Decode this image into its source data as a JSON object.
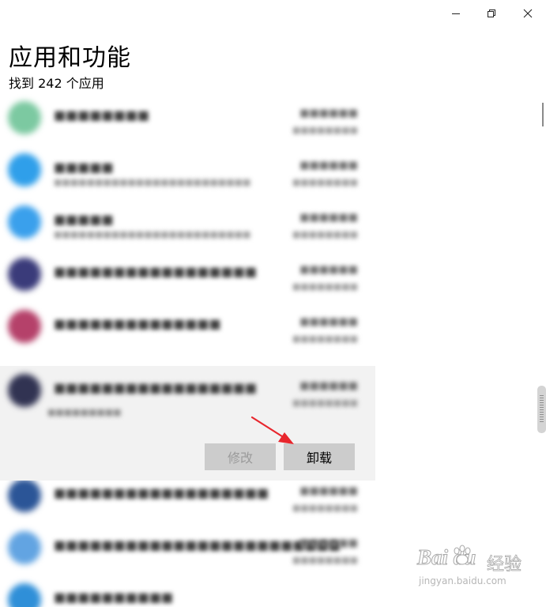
{
  "window": {
    "controls": {
      "minimize": "minimize-icon",
      "restore": "restore-icon",
      "close": "close-icon"
    }
  },
  "header": {
    "title": "应用和功能",
    "count_text": "找到 242 个应用"
  },
  "app_list": {
    "rows": [
      {
        "icon_color": "#7cc9a1"
      },
      {
        "icon_color": "#2f9fea"
      },
      {
        "icon_color": "#3aa0ec"
      },
      {
        "icon_color": "#3a3b7a"
      },
      {
        "icon_color": "#b5416a"
      },
      {
        "icon_color": "#313352"
      },
      {
        "icon_color": "#2b5597"
      },
      {
        "icon_color": "#62a4e2"
      },
      {
        "icon_color": "#2f8fd8"
      }
    ]
  },
  "selected_app": {
    "modify_label": "修改",
    "uninstall_label": "卸载"
  },
  "annotation": {
    "arrow_color": "#e8262d"
  },
  "watermark": {
    "logo": "Bai  du",
    "jingyan": "经验",
    "url": "jingyan.baidu.com"
  }
}
